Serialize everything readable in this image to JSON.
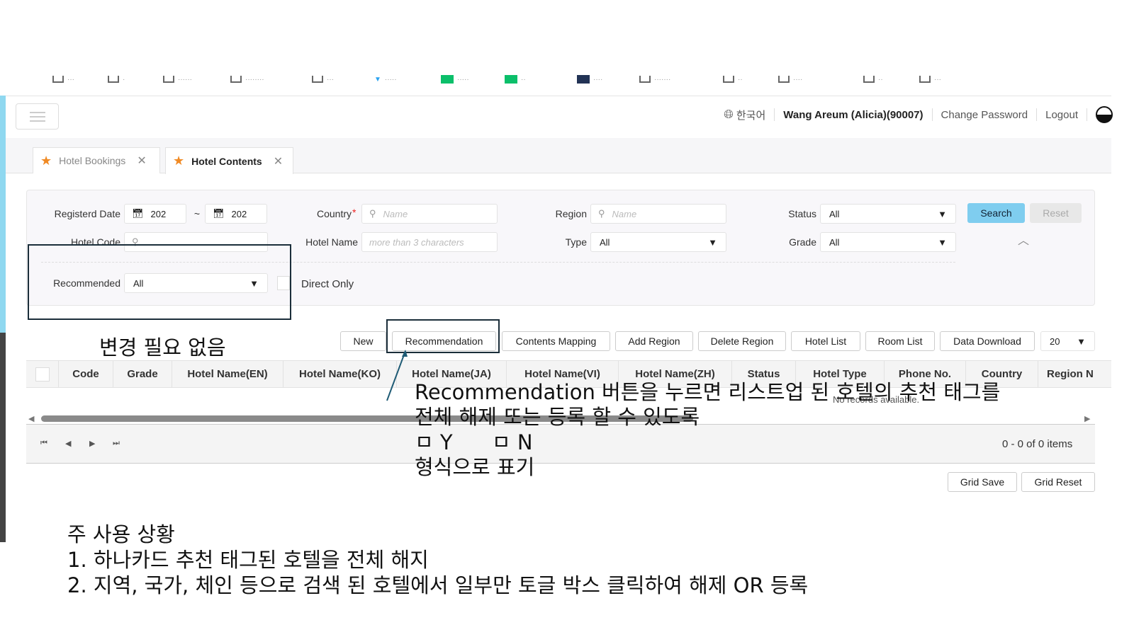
{
  "header": {
    "language": "한국어",
    "user": "Wang Areum (Alicia)(90007)",
    "change_password": "Change Password",
    "logout": "Logout"
  },
  "tabs": [
    {
      "label": "Hotel Bookings",
      "active": false
    },
    {
      "label": "Hotel Contents",
      "active": true
    }
  ],
  "filters": {
    "registered_date_label": "Registerd Date",
    "date_from": "202",
    "date_sep": "~",
    "date_to": "202",
    "country_label": "Country",
    "required_mark": "*",
    "country_placeholder": "Name",
    "region_label": "Region",
    "region_placeholder": "Name",
    "status_label": "Status",
    "status_value": "All",
    "hotel_code_label": "Hotel Code",
    "hotel_name_label": "Hotel Name",
    "hotel_name_placeholder": "more than 3 characters",
    "type_label": "Type",
    "type_value": "All",
    "grade_label": "Grade",
    "grade_value": "All",
    "recommended_label": "Recommended",
    "recommended_value": "All",
    "direct_only_label": "Direct Only",
    "search": "Search",
    "reset": "Reset"
  },
  "toolbar": {
    "new": "New",
    "recommendation": "Recommendation",
    "contents_mapping": "Contents Mapping",
    "add_region": "Add Region",
    "delete_region": "Delete Region",
    "hotel_list": "Hotel List",
    "room_list": "Room List",
    "data_download": "Data Download",
    "page_size": "20"
  },
  "table": {
    "columns": [
      "Code",
      "Grade",
      "Hotel Name(EN)",
      "Hotel Name(KO)",
      "Hotel Name(JA)",
      "Hotel Name(VI)",
      "Hotel Name(ZH)",
      "Status",
      "Hotel Type",
      "Phone No.",
      "Country",
      "Region N"
    ],
    "empty": "No records available."
  },
  "pager": {
    "summary": "0 - 0 of 0 items"
  },
  "footer": {
    "grid_save": "Grid Save",
    "grid_reset": "Grid Reset"
  },
  "annotations": {
    "no_change": "변경 필요 없음",
    "rec_line1": "Recommendation 버튼을 누르면  리스트업 된 호텔의 추천 태그를",
    "rec_line2": "전체 해제 또는 등록 할 수 있도록",
    "rec_line3": "ㅁ Y      ㅁ N",
    "rec_line4": "형식으로 표기",
    "usage_title": "주 사용 상황",
    "usage_1": "1. 하나카드 추천 태그된 호텔을 전체 해지",
    "usage_2": "2. 지역, 국가, 체인 등으로 검색 된 호텔에서 일부만 토글 박스 클릭하여 해제 OR 등록"
  }
}
